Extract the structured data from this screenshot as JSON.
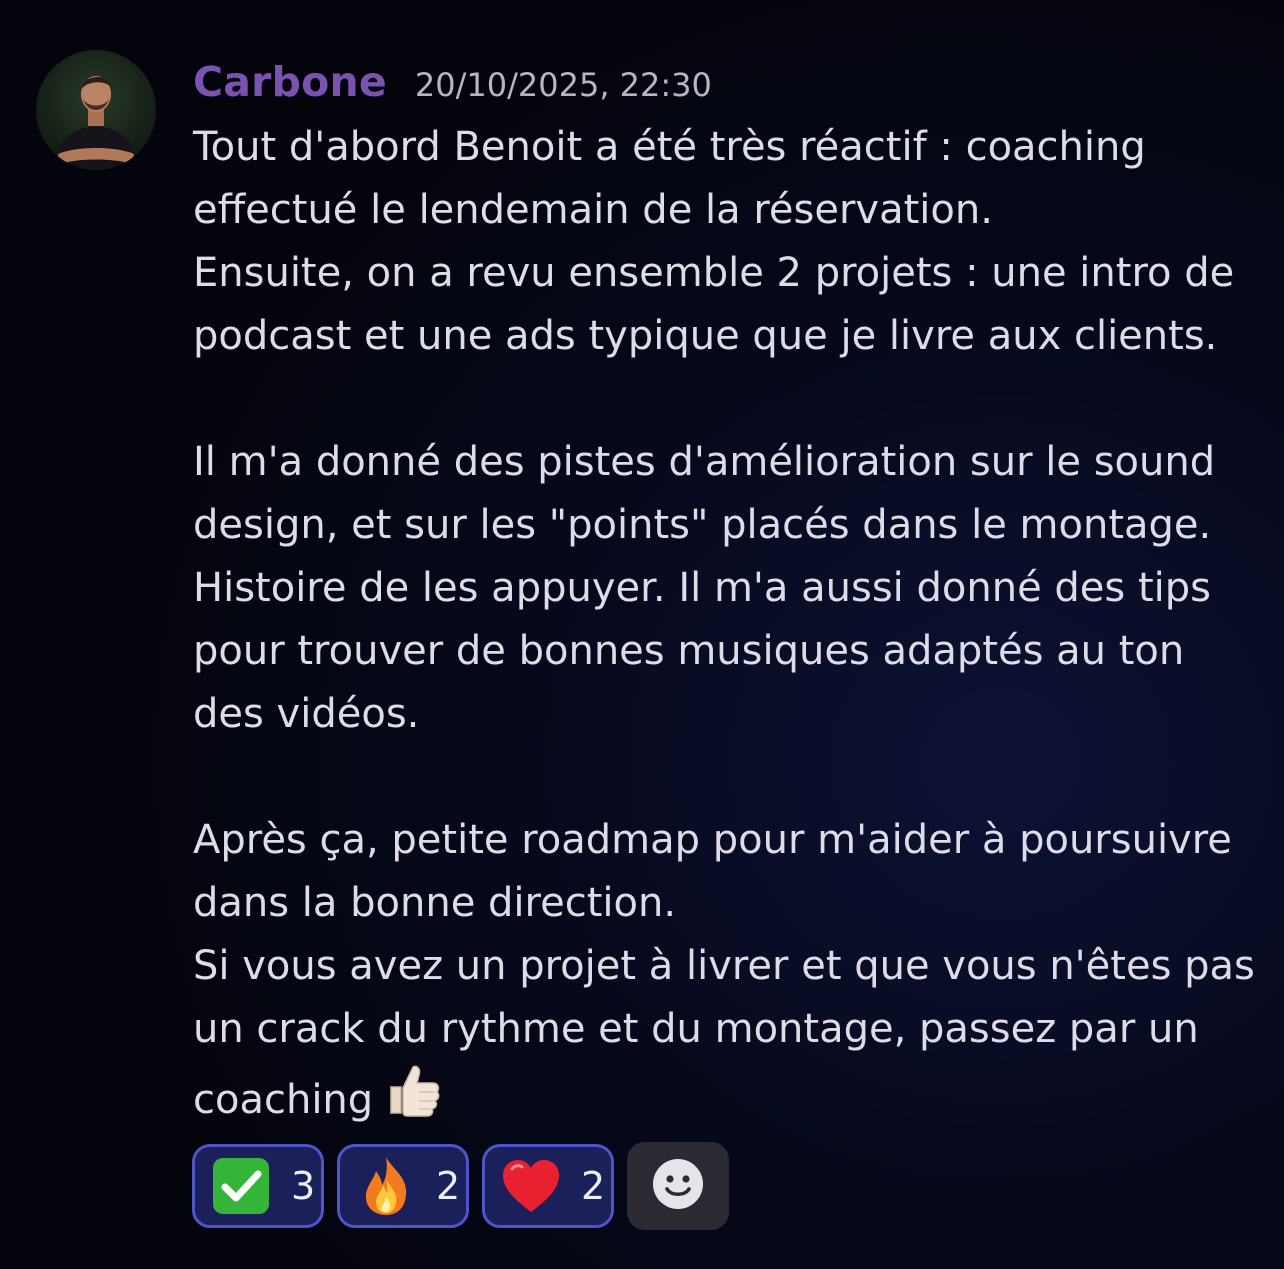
{
  "message": {
    "author": "Carbone",
    "timestamp": "20/10/2025, 22:30",
    "avatar_icon": "user-avatar-icon",
    "lines": [
      "Tout d'abord Benoit a été très réactif : coaching",
      "effectué le lendemain de la réservation.",
      "Ensuite, on a revu ensemble 2 projets : une intro de",
      "podcast et une ads typique que je livre aux clients.",
      "",
      "Il m'a donné des pistes d'amélioration sur le sound",
      "design, et sur les \"points\" placés dans le montage.",
      "Histoire de les appuyer. Il m'a aussi donné des tips",
      "pour trouver de bonnes musiques adaptés au ton",
      "des vidéos.",
      "",
      "Après ça, petite roadmap pour m'aider à poursuivre",
      "dans la bonne direction.",
      "Si vous avez un projet à livrer et que vous n'êtes pas",
      "un crack du rythme et du montage, passez par un",
      "coaching"
    ],
    "trailing_emoji": "thumbs-up-icon"
  },
  "reactions": [
    {
      "emoji": "check-mark-icon",
      "count": "3"
    },
    {
      "emoji": "fire-icon",
      "count": "2"
    },
    {
      "emoji": "red-heart-icon",
      "count": "2"
    }
  ],
  "add_reaction_icon": "smiley-add-reaction-icon",
  "colors": {
    "username": "#7a52b0",
    "reaction_bg": "#1b1f5a",
    "reaction_border": "#4d55c8",
    "add_reaction_bg": "#2b2c33"
  }
}
